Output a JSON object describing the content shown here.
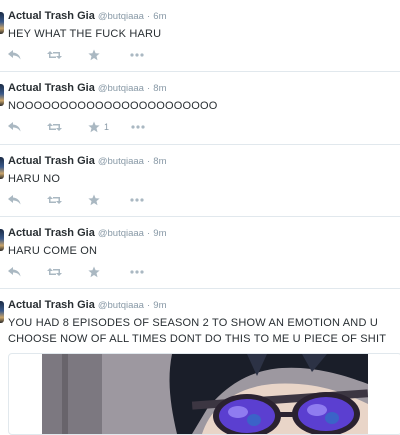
{
  "tweets": [
    {
      "name": "Actual Trash Gia",
      "handle": "@butqiaaa",
      "sep": "·",
      "time": "6m",
      "text": "HEY WHAT THE FUCK HARU",
      "favorites": ""
    },
    {
      "name": "Actual Trash Gia",
      "handle": "@butqiaaa",
      "sep": "·",
      "time": "8m",
      "text": "NOOOOOOOOOOOOOOOOOOOOOOO",
      "favorites": "1"
    },
    {
      "name": "Actual Trash Gia",
      "handle": "@butqiaaa",
      "sep": "·",
      "time": "8m",
      "text": "HARU NO",
      "favorites": ""
    },
    {
      "name": "Actual Trash Gia",
      "handle": "@butqiaaa",
      "sep": "·",
      "time": "9m",
      "text": "HARU COME ON",
      "favorites": ""
    },
    {
      "name": "Actual Trash Gia",
      "handle": "@butqiaaa",
      "sep": "·",
      "time": "9m",
      "text": "YOU HAD 8 EPISODES OF SEASON 2 TO SHOW AN EMOTION AND U CHOOSE NOW OF ALL TIMES DONT DO THIS TO ME U PIECE OF SHIT",
      "favorites": ""
    }
  ],
  "icons": {
    "reply": "reply-arrow-icon",
    "retweet": "retweet-icon",
    "favorite": "star-icon",
    "more": "more-dots-icon"
  },
  "colors": {
    "text": "#292f33",
    "muted": "#8899a6",
    "action": "#aab8c2",
    "divider": "#e1e8ed"
  }
}
